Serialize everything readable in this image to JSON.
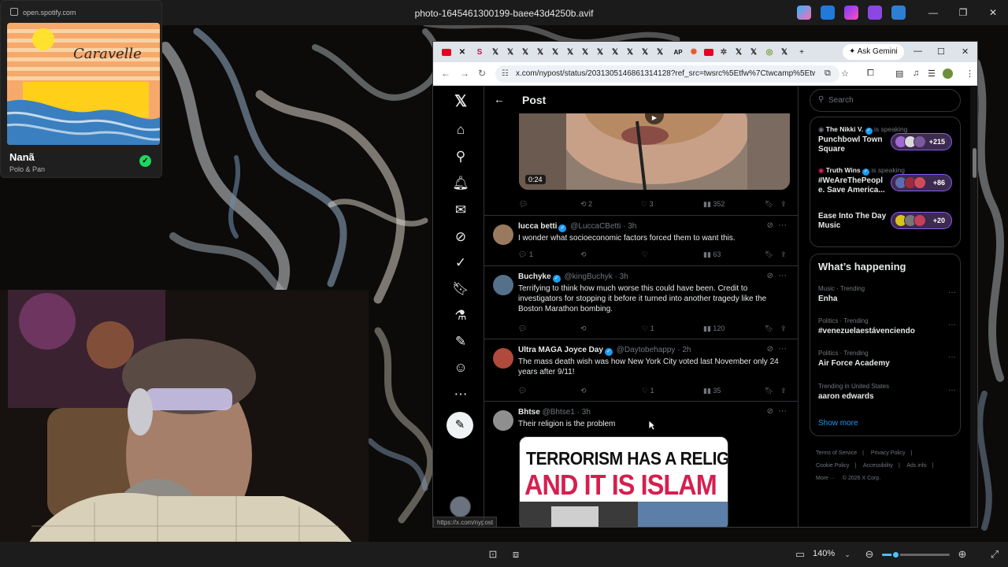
{
  "viewer": {
    "title": "photo-1645461300199-baee43d4250b.avif",
    "zoom_level": "140%"
  },
  "spotify": {
    "url": "open.spotify.com",
    "song_title": "Nanã",
    "artist": "Polo & Pan",
    "album_script": "Caravelle"
  },
  "browser": {
    "ask_gemini": "Ask Gemini",
    "url": "x.com/nypost/status/2031305146861314128?ref_src=twsrc%5Etfw%7Ctwcamp%5Etweetem...",
    "tab_active_letter": "S",
    "tab_ap_letter": "AP",
    "status_link": "https://x.com/nypost"
  },
  "x": {
    "header_title": "Post",
    "video": {
      "duration": "0:24",
      "actions": {
        "retweets": "2",
        "likes": "3",
        "views": "352"
      }
    },
    "tweets": [
      {
        "name": "lucca betti",
        "handle": "@LuccaCBetti",
        "time": "· 3h",
        "text": "I wonder what socioeconomic factors forced them to want this.",
        "replies": "1",
        "retweets": "",
        "likes": "",
        "views": "63"
      },
      {
        "name": "Buchyke",
        "handle": "@kingBuchyk",
        "time": "· 3h",
        "text": "Terrifying to think how much worse this could have been. Credit to investigators for stopping it before it turned into another tragedy like the Boston Marathon bombing.",
        "replies": "",
        "retweets": "",
        "likes": "1",
        "views": "120"
      },
      {
        "name": "Ultra MAGA Joyce Day",
        "handle": "@Daytobehappy",
        "time": "· 2h",
        "text": "The mass death wish was how New York City voted last November only 24 years after 9/11!",
        "replies": "",
        "retweets": "",
        "likes": "1",
        "views": "35"
      },
      {
        "name": "Bhtse",
        "handle": "@Bhtse1",
        "time": "· 3h",
        "text": "Their religion is the problem",
        "replies": "",
        "retweets": "",
        "likes": "",
        "views": ""
      }
    ],
    "meme": {
      "line1": "TERRORISM HAS A RELIGION",
      "line2": "AND IT IS ISLAM"
    },
    "search_placeholder": "Search",
    "spaces": [
      {
        "host": "The Nikki V.",
        "status": "is speaking",
        "name": "Punchbowl Town Square",
        "count": "+215"
      },
      {
        "host": "Truth Wins",
        "status": "is speaking",
        "name": "#WeAreThePeopl e. Save America...",
        "count": "+86"
      },
      {
        "host": "",
        "status": "",
        "name": "Ease Into The Day Music",
        "count": "+20"
      }
    ],
    "trends_title": "What’s happening",
    "trends": [
      {
        "category": "Music · Trending",
        "term": "Enha"
      },
      {
        "category": "Politics · Trending",
        "term": "#venezuelaestávenciendo"
      },
      {
        "category": "Politics · Trending",
        "term": "Air Force Academy"
      },
      {
        "category": "Trending in United States",
        "term": "aaron edwards"
      }
    ],
    "show_more": "Show more",
    "footer": [
      "Terms of Service",
      "|",
      "Privacy Policy",
      "|",
      "Cookie Policy",
      "|",
      "Accessibility",
      "|",
      "Ads info",
      "|",
      "More ···",
      "© 2026 X Corp."
    ]
  },
  "colors": {
    "x_blue": "#1d9bf0",
    "spotify_green": "#1ed760",
    "meme_red": "#d61f4f",
    "space_purple": "#8b5cf6"
  }
}
